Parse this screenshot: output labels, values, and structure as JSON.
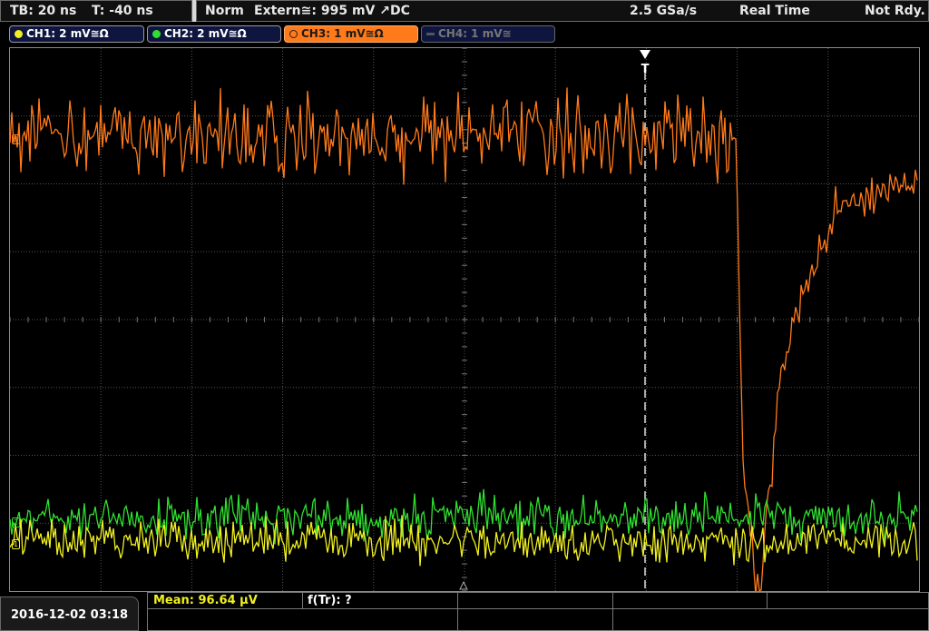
{
  "topbar": {
    "timebase": "TB: 20 ns",
    "trigger_offset": "T: -40 ns",
    "trigger_mode": "Norm",
    "trigger_source": "Extern≅: 995 mV ↗DC",
    "sample_rate": "2.5 GSa/s",
    "acq_mode": "Real Time",
    "status": "Not Rdy."
  },
  "channels": [
    {
      "id": "ch1",
      "label": "CH1: 2 mV≅Ω",
      "color": "#f0f020",
      "active": true,
      "selected": false
    },
    {
      "id": "ch2",
      "label": "CH2: 2 mV≅Ω",
      "color": "#30e030",
      "active": true,
      "selected": false
    },
    {
      "id": "ch3",
      "label": "CH3: 1 mV≅Ω",
      "color": "#ff7a1a",
      "active": true,
      "selected": true
    },
    {
      "id": "ch4",
      "label": "CH4: 1 mV≅",
      "color": "#707070",
      "active": false,
      "selected": false
    }
  ],
  "markers": {
    "ch1": "1",
    "ch2": "2",
    "ch3": "3",
    "trigger": "T"
  },
  "bottom": {
    "datetime": "2016-12-02 03:18",
    "measurement_1": "Mean: 96.64 µV",
    "measurement_2": "f(Tr): ?"
  },
  "colors": {
    "grid": "#555555",
    "ch1": "#f0f020",
    "ch2": "#30e030",
    "ch3": "#ff7a1a",
    "trigger": "#ffffff"
  }
}
